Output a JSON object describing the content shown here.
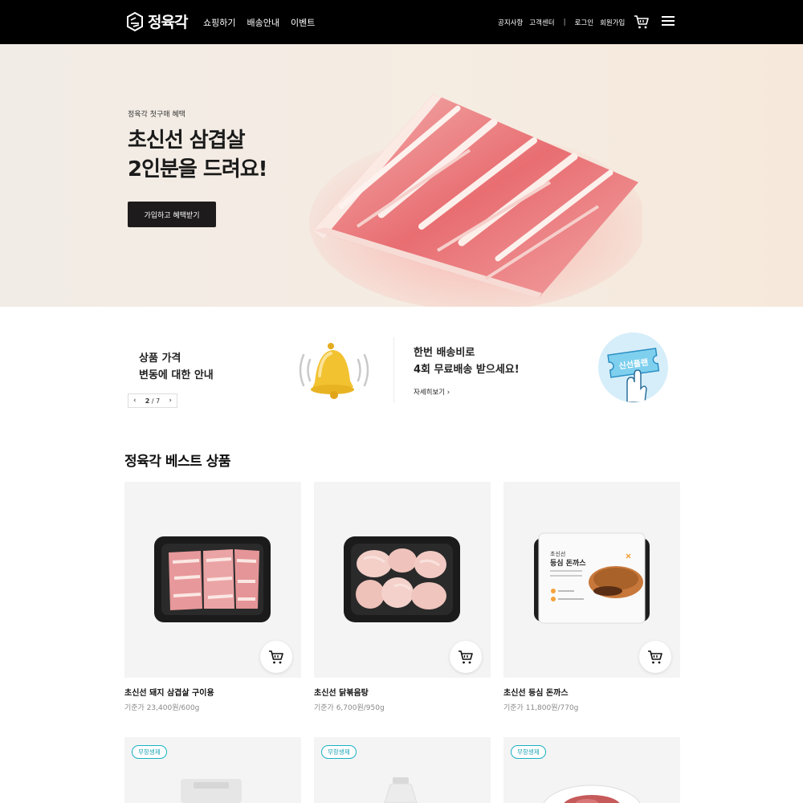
{
  "header": {
    "logo_text": "정육각",
    "nav": [
      "쇼핑하기",
      "배송안내",
      "이벤트"
    ],
    "util": {
      "notice": "공지사항",
      "support": "고객센터",
      "separator": "|",
      "login": "로그인",
      "signup": "회원가입"
    }
  },
  "banner": {
    "subtitle": "정육각 첫구매 혜택",
    "title_line1": "초신선 삼겹살",
    "title_line2": "2인분을 드려요!",
    "button_label": "가입하고 혜택받기"
  },
  "info": {
    "left_line1": "상품 가격",
    "left_line2": "변동에 대한  안내",
    "pager_prev": "‹",
    "pager_current": "2",
    "pager_sep": "/",
    "pager_total": "7",
    "pager_next": "›",
    "right_line1": "한번 배송비로",
    "right_line2": "4회 무료배송 받으세요!",
    "detail_link": "자세히보기 ›",
    "ticket_text": "신선플랜"
  },
  "best": {
    "title": "정육각 베스트 상품",
    "products": [
      {
        "name": "초신선 돼지 삼겹살 구이용",
        "price": "기준가 23,400원/600g"
      },
      {
        "name": "초신선 닭볶음탕",
        "price": "기준가 6,700원/950g"
      },
      {
        "name": "초신선 등심 돈까스",
        "price": "기준가 11,800원/770g",
        "package_brand": "초신선",
        "package_title": "등심 돈까스"
      }
    ],
    "next_row_badges": [
      "무항생제",
      "무항생제",
      "무항생제"
    ]
  },
  "colors": {
    "header_bg": "#000000",
    "banner_button": "#1d1b1b",
    "badge_accent": "#19b0c4",
    "bell": "#f2c230",
    "ticket_bg": "#d6eef9"
  },
  "icons": [
    "logo-icon",
    "cart-icon",
    "menu-icon",
    "bell-icon",
    "ticket-icon"
  ]
}
